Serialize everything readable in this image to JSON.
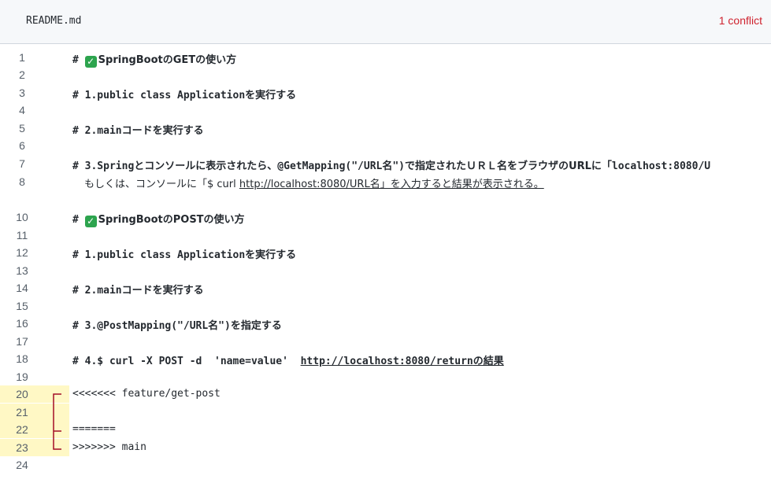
{
  "file": {
    "name": "README.md",
    "conflicts": "1 conflict"
  },
  "lines": {
    "l1": {
      "num": "1",
      "pre": "# ",
      "text": "SpringBootのGETの使い方"
    },
    "l2": {
      "num": "2"
    },
    "l3": {
      "num": "3",
      "pre": "# 1.public class Application",
      "text": "を実行する"
    },
    "l4": {
      "num": "4"
    },
    "l5": {
      "num": "5",
      "pre": "# 2.main",
      "text": "コードを実行する"
    },
    "l6": {
      "num": "6"
    },
    "l7": {
      "num": "7",
      "a": "# 3.Spring",
      "b": "とコンソールに表示されたら、",
      "c": "@GetMapping(\"/URL名\")",
      "d": "で指定されたＵＲＬ名をブラウザのURLに「",
      "e": "localhost:8080/U"
    },
    "l8": {
      "num": "8",
      "a": "もしくは、コンソールに「$ curl ",
      "link": "http://localhost:8080/URL名」を入力すると結果が表示される。"
    },
    "l10": {
      "num": "10",
      "pre": "# ",
      "text": "SpringBootのPOSTの使い方"
    },
    "l11": {
      "num": "11"
    },
    "l12": {
      "num": "12",
      "pre": "# 1.public class Application",
      "text": "を実行する"
    },
    "l13": {
      "num": "13"
    },
    "l14": {
      "num": "14",
      "pre": "# 2.main",
      "text": "コードを実行する"
    },
    "l15": {
      "num": "15"
    },
    "l16": {
      "num": "16",
      "pre": "# 3.@PostMapping(\"/URL名\")",
      "text": "を指定する"
    },
    "l17": {
      "num": "17"
    },
    "l18": {
      "num": "18",
      "pre": "# 4.$ curl -X POST -d  'name=value'  ",
      "link": "http://localhost:8080/return",
      "text": "の結果"
    },
    "l19": {
      "num": "19"
    },
    "l20": {
      "num": "20",
      "text": "<<<<<<< feature/get-post"
    },
    "l21": {
      "num": "21"
    },
    "l22": {
      "num": "22",
      "text": "======="
    },
    "l23": {
      "num": "23",
      "text": ">>>>>>> main"
    },
    "l24": {
      "num": "24"
    }
  },
  "icons": {
    "heading_check": "check-mark-icon"
  },
  "colors": {
    "conflict_red": "#cf222e",
    "conflict_highlight": "#fff8c5",
    "check_green": "#2da44e",
    "bracket_red": "#a40e26"
  }
}
